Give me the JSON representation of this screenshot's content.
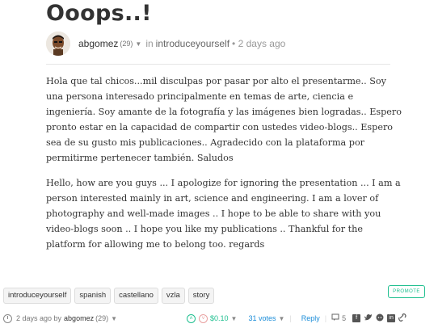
{
  "post": {
    "title": "Ooops..!",
    "author": "abgomez",
    "reputation": "(29)",
    "in_word": "in",
    "category": "introduceyourself",
    "age": "2 days ago"
  },
  "body": {
    "paragraphs": [
      "Hola que tal chicos...mil disculpas por pasar por alto el presentarme.. Soy una persona interesado principalmente en temas de arte, ciencia e ingeniería. Soy amante de la fotografía y las imágenes bien logradas.. Espero pronto estar en la capacidad de compartir con ustedes video-blogs.. Espero sea de su gusto mis publicaciones.. Agradecido con la plataforma por permitirme pertenecer también. Saludos",
      "Hello, how are you guys ... I apologize for ignoring the presentation ... I am a person interested mainly in art, science and engineering. I am a lover of photography and well-made images .. I hope to be able to share with you video-blogs soon .. I hope you like my publications .. Thankful for the platform for allowing me to belong too. regards"
    ]
  },
  "tags": [
    "introduceyourself",
    "spanish",
    "castellano",
    "vzla",
    "story"
  ],
  "promote_label": "PROMOTE",
  "footer": {
    "age": "2 days ago by",
    "author": "abgomez",
    "reputation": "(29)",
    "payout": "$0.10",
    "votes": "31 votes",
    "reply": "Reply",
    "comments": "5"
  },
  "colors": {
    "accent_green": "#1fbf8f",
    "link_blue": "#1a8cd8"
  },
  "icons": [
    "caret-down-icon",
    "clock-icon",
    "upvote-icon",
    "downvote-icon",
    "comment-icon",
    "facebook-icon",
    "twitter-icon",
    "reddit-icon",
    "linkedin-icon",
    "link-icon"
  ]
}
